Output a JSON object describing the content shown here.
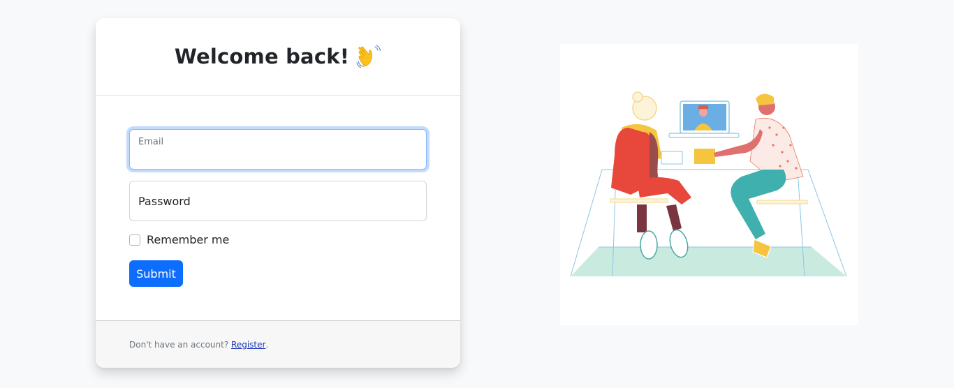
{
  "login": {
    "title": "Welcome back!",
    "title_icon": "waving-hand-icon",
    "email_label": "Email",
    "email_value": "",
    "password_label": "Password",
    "remember_label": "Remember me",
    "remember_checked": false,
    "submit_label": "Submit"
  },
  "footer": {
    "text": "Don't have an account?",
    "link_label": "Register",
    "suffix": "."
  },
  "illustration": {
    "icon": "video-call-illustration"
  },
  "colors": {
    "primary": "#0d6efd",
    "background": "#f8f9fa",
    "card": "#ffffff",
    "footer": "#f7f7f7"
  }
}
